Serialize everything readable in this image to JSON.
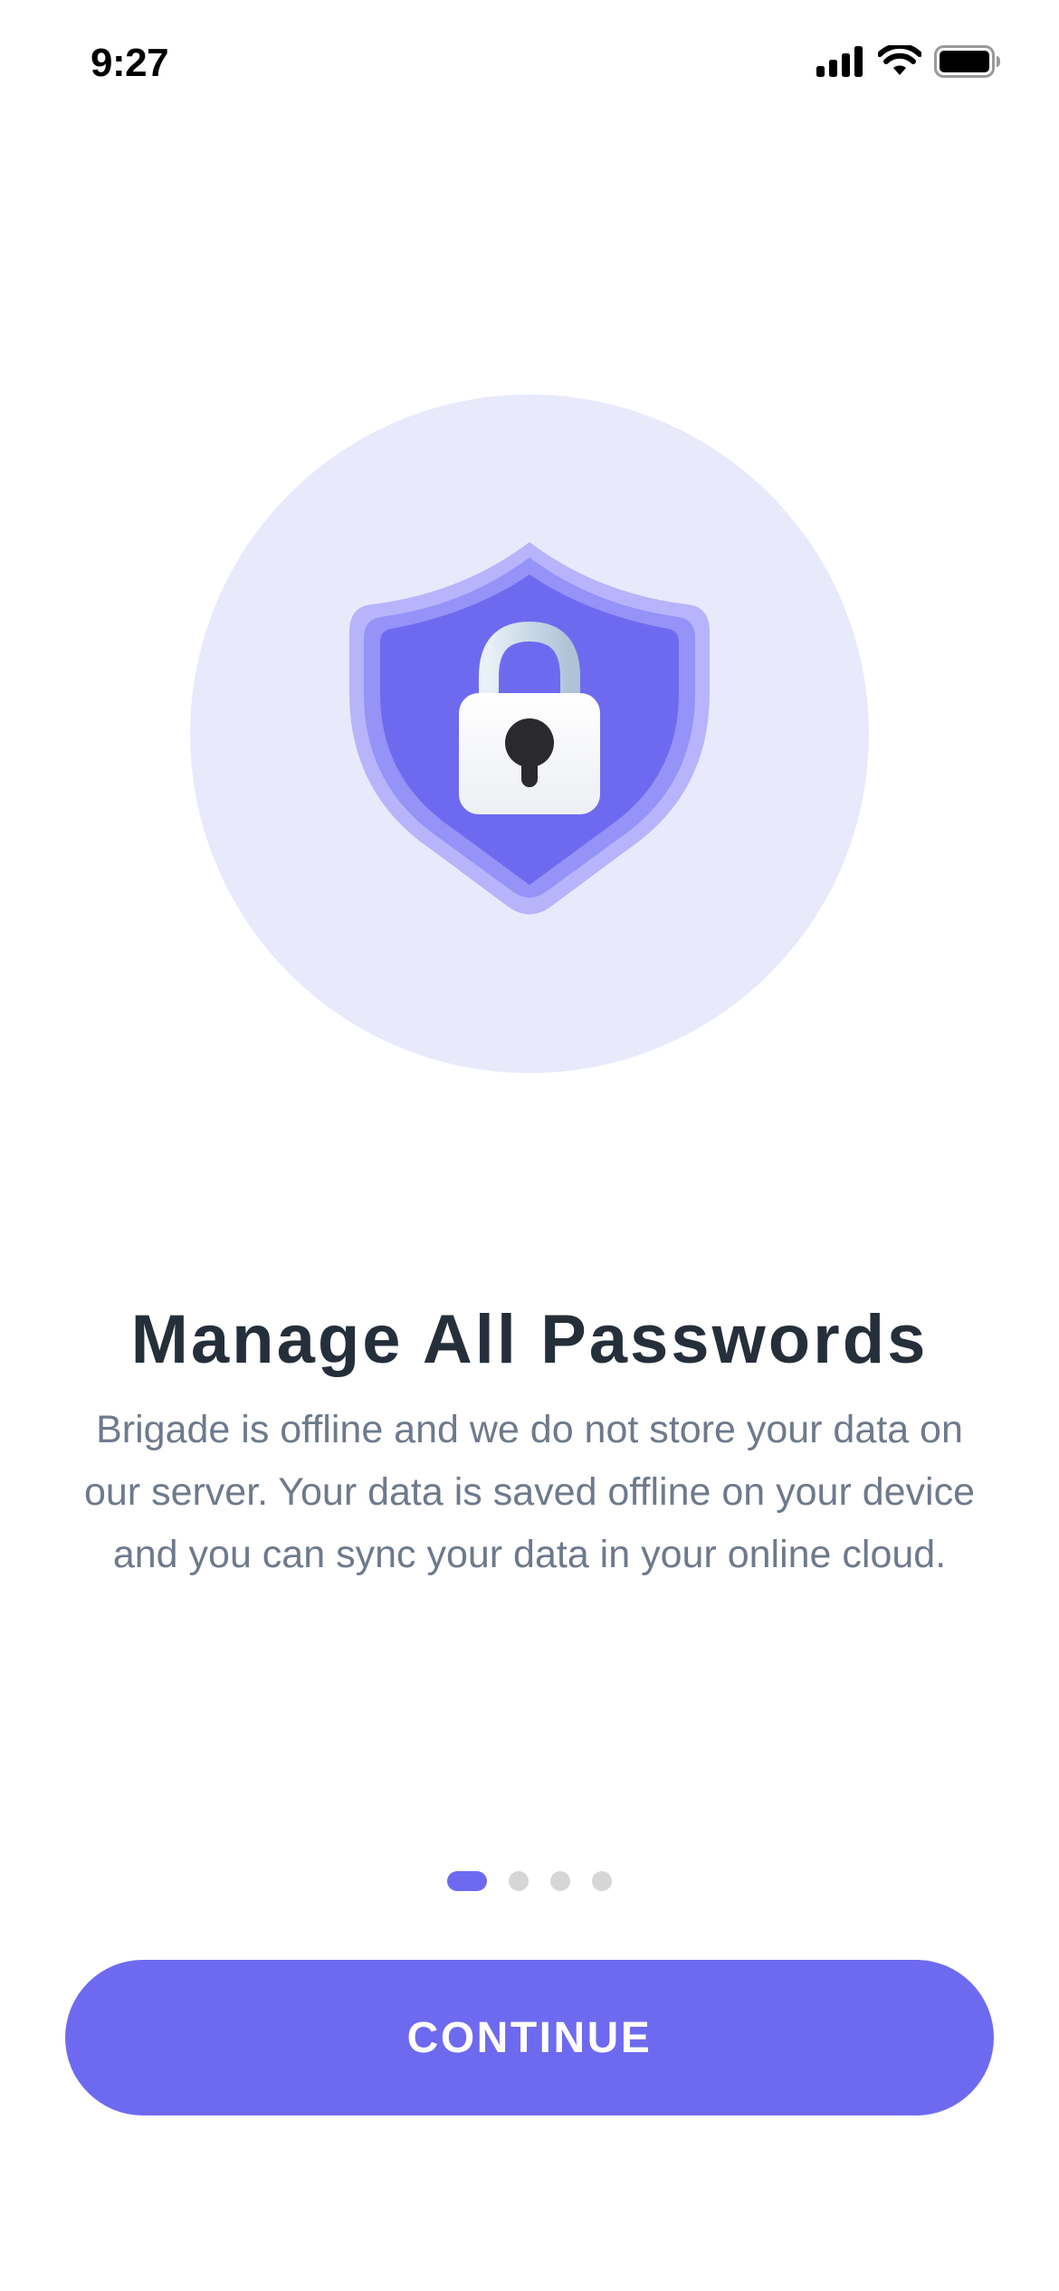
{
  "status_bar": {
    "time": "9:27",
    "icons": [
      "cellular-signal-icon",
      "wifi-icon",
      "battery-icon"
    ]
  },
  "hero": {
    "icon": "shield-lock-icon"
  },
  "onboarding": {
    "title": "Manage All Passwords",
    "description": "Brigade is offline and we do not store your data on our server. Your data is saved offline on your device and you can sync your data in your online cloud."
  },
  "pager": {
    "current_page": 1,
    "total_pages": 4
  },
  "actions": {
    "continue_label": "CONTINUE"
  },
  "colors": {
    "accent": "#6E6AF0",
    "hero_circle": "#E9E9FC",
    "title": "#252F3A",
    "body_text": "#6E7A8C",
    "dot_inactive": "#D6D6D6"
  }
}
